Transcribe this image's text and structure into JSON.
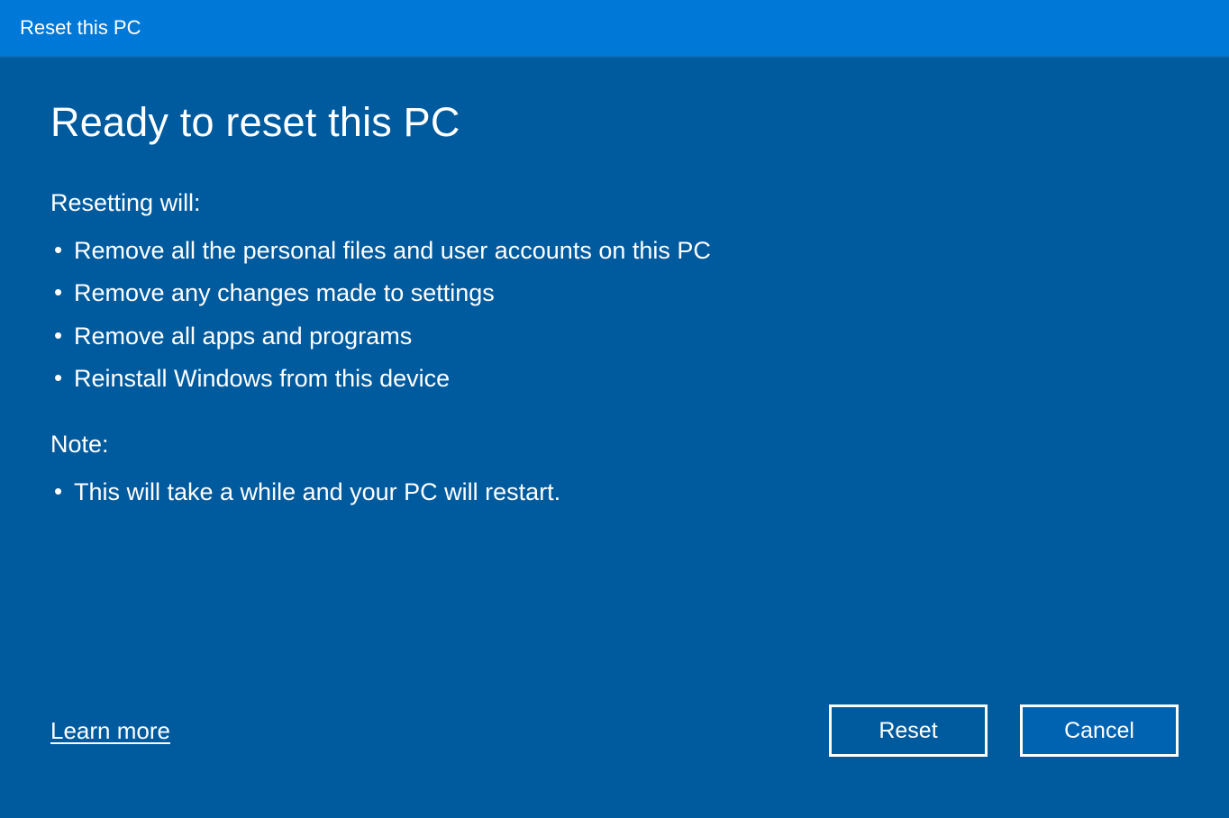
{
  "titlebar": {
    "title": "Reset this PC"
  },
  "heading": "Ready to reset this PC",
  "resetting": {
    "label": "Resetting will:",
    "items": [
      "Remove all the personal files and user accounts on this PC",
      "Remove any changes made to settings",
      "Remove all apps and programs",
      "Reinstall Windows from this device"
    ]
  },
  "note": {
    "label": "Note:",
    "items": [
      "This will take a while and your PC will restart."
    ]
  },
  "footer": {
    "learn_more": "Learn more",
    "reset": "Reset",
    "cancel": "Cancel"
  }
}
